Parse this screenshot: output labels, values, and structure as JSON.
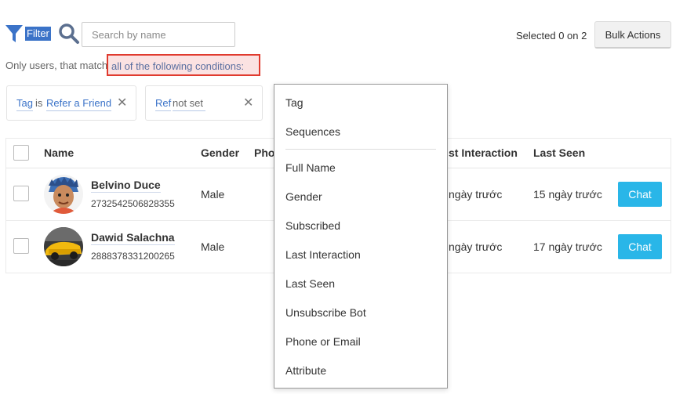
{
  "toolbar": {
    "filter_label": "Filter",
    "search_placeholder": "Search by name",
    "selected_text": "Selected 0 on 2",
    "bulk_actions_label": "Bulk Actions"
  },
  "conditions": {
    "prefix": "Only users, that match",
    "match_mode": "all of the following conditions:"
  },
  "filters": [
    {
      "key": "Tag",
      "op": "is",
      "value": "Refer a Friend"
    },
    {
      "key": "Ref",
      "op": "",
      "value": "not set"
    }
  ],
  "table": {
    "headers": {
      "name": "Name",
      "gender": "Gender",
      "phone": "Pho",
      "last_interaction": "st Interaction",
      "last_seen": "Last Seen"
    },
    "rows": [
      {
        "name": "Belvino Duce",
        "id": "2732542506828355",
        "gender": "Male",
        "last_interaction": "ngày trước",
        "last_seen": "15 ngày trước",
        "action": "Chat"
      },
      {
        "name": "Dawid Salachna",
        "id": "2888378331200265",
        "gender": "Male",
        "last_interaction": "ngày trước",
        "last_seen": "17 ngày trước",
        "action": "Chat"
      }
    ]
  },
  "dropdown": {
    "group1": [
      "Tag",
      "Sequences"
    ],
    "group2": [
      "Full Name",
      "Gender",
      "Subscribed",
      "Last Interaction",
      "Last Seen",
      "Unsubscribe Bot",
      "Phone or Email",
      "Attribute"
    ]
  },
  "colors": {
    "accent": "#3b73c8",
    "chat_button": "#29b6e8",
    "highlight_border": "#e03b2f"
  }
}
